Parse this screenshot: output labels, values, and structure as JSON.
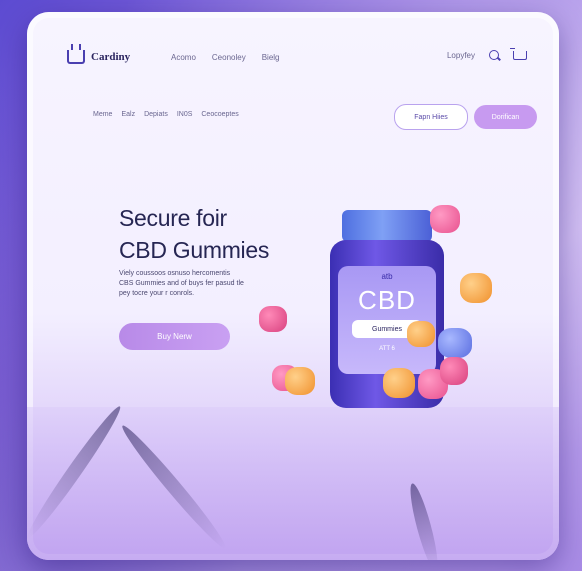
{
  "brand": {
    "name": "Cardiny",
    "logo_icon": "cart-logo-icon"
  },
  "top_nav": {
    "items": [
      "Acomo",
      "Ceonoley",
      "Bielg"
    ]
  },
  "top_right": {
    "link": "Lopyfey",
    "search_icon": "search-icon",
    "cart_icon": "cart-icon"
  },
  "sub_nav": {
    "items": [
      "Meme",
      "Ealz",
      "Depiats",
      "IN0S",
      "Ceocoeptes"
    ]
  },
  "actions": {
    "outline_label": "Fapn Hiies",
    "filled_label": "Dorifican"
  },
  "hero": {
    "title_lines": [
      "Secure foir",
      "CBD Gummies"
    ],
    "text_lines": [
      "Viely coussoos osnuso hercomentis",
      "CBS Gummies and of buys fer pasud tle",
      "pey tocre your r conrols."
    ],
    "button_label": "Buy Nerw"
  },
  "product": {
    "label_logo": "atb",
    "label_title": "CBD",
    "label_pill": "Gummies",
    "label_footer": "ATT 6"
  },
  "colors": {
    "accent": "#c79af0",
    "bottle": "#5a45d6",
    "title": "#262653",
    "background": "#8f6fe0"
  }
}
